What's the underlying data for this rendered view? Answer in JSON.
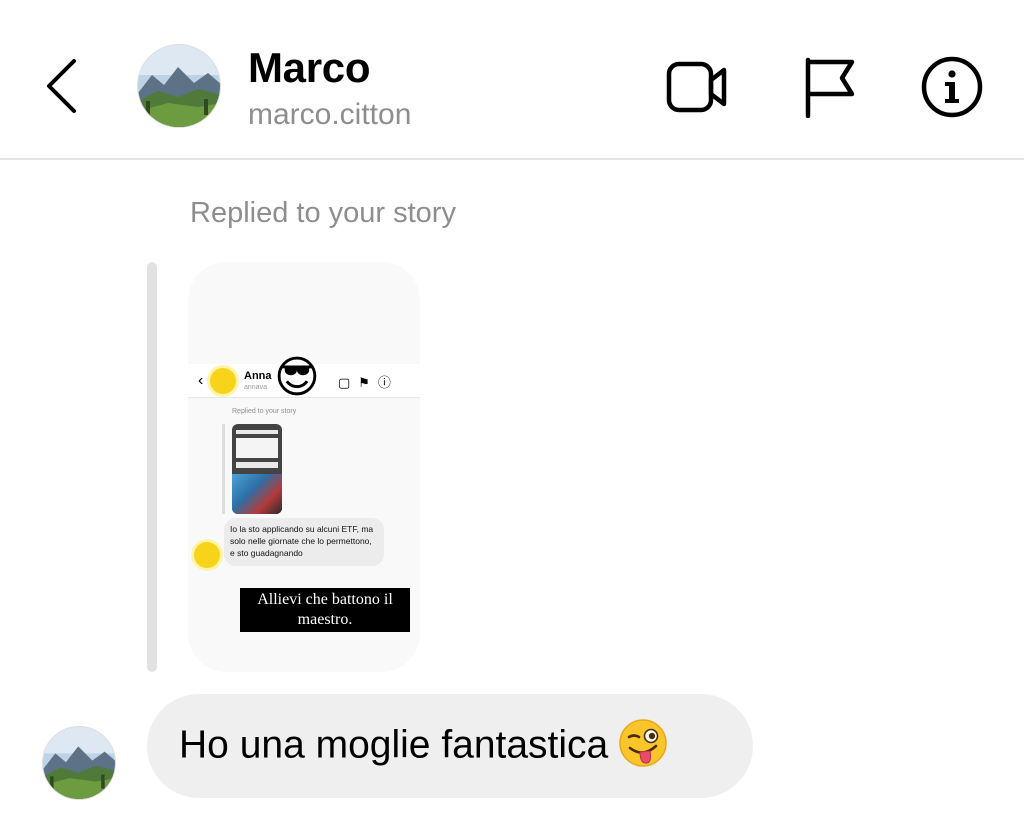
{
  "header": {
    "name": "Marco",
    "username": "marco.citton"
  },
  "thread": {
    "replied_label": "Replied to your story",
    "story_preview": {
      "contact_name": "Anna",
      "contact_handle": "annava",
      "replied_label": "Replied to your story",
      "reply_message": "Io la sto applicando su alcuni ETF, ma solo nelle giornate che lo permettono, e sto guadagnando",
      "caption": "Allievi che battono il maestro.",
      "sticker_emoji": "😎"
    },
    "message": {
      "text": "Ho una moglie fantastica",
      "emoji_icon": "winking-face-with-tongue-icon"
    }
  },
  "icons": {
    "back": "chevron-left-icon",
    "video": "video-camera-icon",
    "report": "flag-icon",
    "info": "info-circle-icon"
  },
  "colors": {
    "secondary_text": "#8e8e8e",
    "bubble": "#efefef",
    "divider": "#e4e4e4"
  }
}
